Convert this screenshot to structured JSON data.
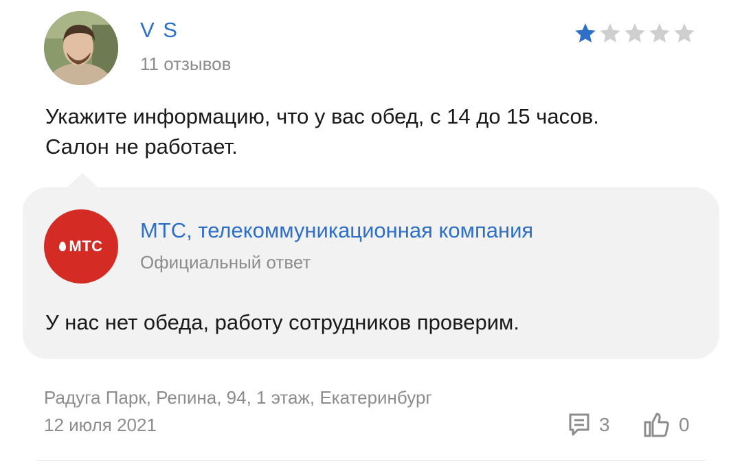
{
  "review": {
    "author": {
      "name": "V S",
      "reviews_count": "11 отзывов",
      "avatar_icon": "user-photo-avatar"
    },
    "rating": {
      "value": 1,
      "max": 5,
      "filled_color": "#2e6fc7",
      "empty_color": "#cfcfcf"
    },
    "text": "Укажите информацию, что у вас обед, с 14 до 15 часов. Салон не работает.",
    "reply": {
      "company_name": "МТС, телекоммуникационная компания",
      "label": "Официальный ответ",
      "logo_text": "МТС",
      "logo_color": "#d42b25",
      "text": "У нас нет обеда, работу сотрудников проверим."
    },
    "location": "Радуга Парк, Репина, 94, 1 этаж, Екатеринбург",
    "date": "12 июля 2021",
    "comments": {
      "icon": "comment-icon",
      "count": "3"
    },
    "likes": {
      "icon": "thumbs-up-icon",
      "count": "0"
    }
  },
  "colors": {
    "accent": "#2e6fc7",
    "muted": "#8c8c8c",
    "reply_bg": "#f2f2f2"
  }
}
